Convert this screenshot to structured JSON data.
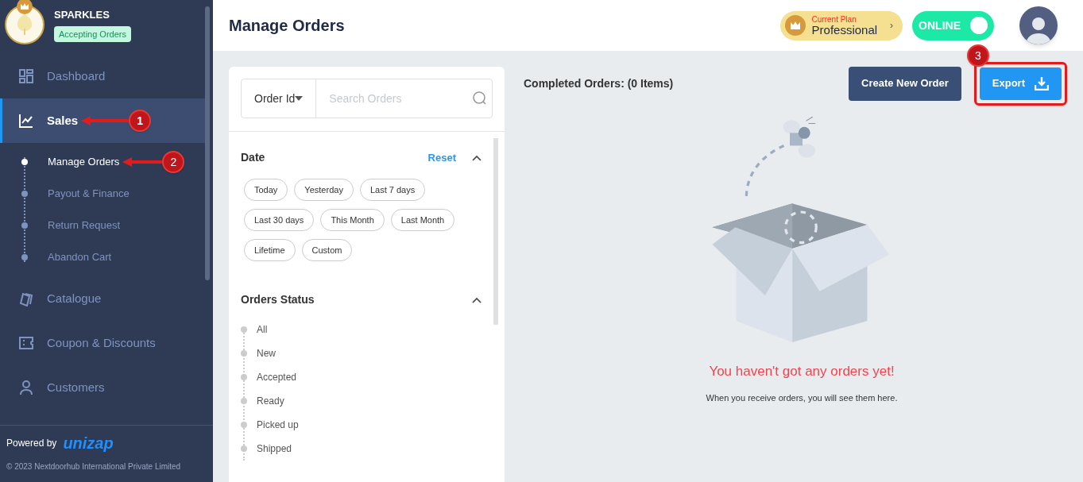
{
  "store": {
    "name": "SPARKLES",
    "status": "Accepting Orders"
  },
  "nav": [
    {
      "label": "Dashboard",
      "kind": "dashboard",
      "selected": false
    },
    {
      "label": "Sales",
      "kind": "chart",
      "selected": true,
      "expanded": true,
      "callout": "1",
      "children": [
        {
          "label": "Manage Orders",
          "selected": true,
          "callout": "2"
        },
        {
          "label": "Payout & Finance",
          "selected": false
        },
        {
          "label": "Return Request",
          "selected": false
        },
        {
          "label": "Abandon Cart",
          "selected": false
        }
      ]
    },
    {
      "label": "Catalogue",
      "kind": "catalogue",
      "selected": false
    },
    {
      "label": "Coupon & Discounts",
      "kind": "coupon",
      "selected": false
    },
    {
      "label": "Customers",
      "kind": "person",
      "selected": false
    }
  ],
  "footer": {
    "powered_by": "Powered by",
    "brand": "unizap",
    "copyright": "© 2023 Nextdoorhub International Private Limited"
  },
  "header": {
    "title": "Manage Orders",
    "plan_label": "Current Plan",
    "plan": "Professional",
    "plan_chevron": "›",
    "online": {
      "label": "ONLINE",
      "on": true
    }
  },
  "filters": {
    "search_type": "Order Id",
    "search_placeholder": "Search Orders",
    "date": {
      "title": "Date",
      "reset": "Reset",
      "chips": [
        "Today",
        "Yesterday",
        "Last 7 days",
        "Last 30 days",
        "This Month",
        "Last Month",
        "Lifetime",
        "Custom"
      ]
    },
    "status": {
      "title": "Orders Status",
      "items": [
        "All",
        "New",
        "Accepted",
        "Ready",
        "Picked up",
        "Shipped"
      ]
    }
  },
  "orders": {
    "heading": "Completed Orders: (0 Items)",
    "create_button": "Create New Order",
    "export_button": "Export",
    "export_callout": "3",
    "empty_title": "You haven't got any orders yet!",
    "empty_text": "When you receive orders, you will see them here."
  }
}
